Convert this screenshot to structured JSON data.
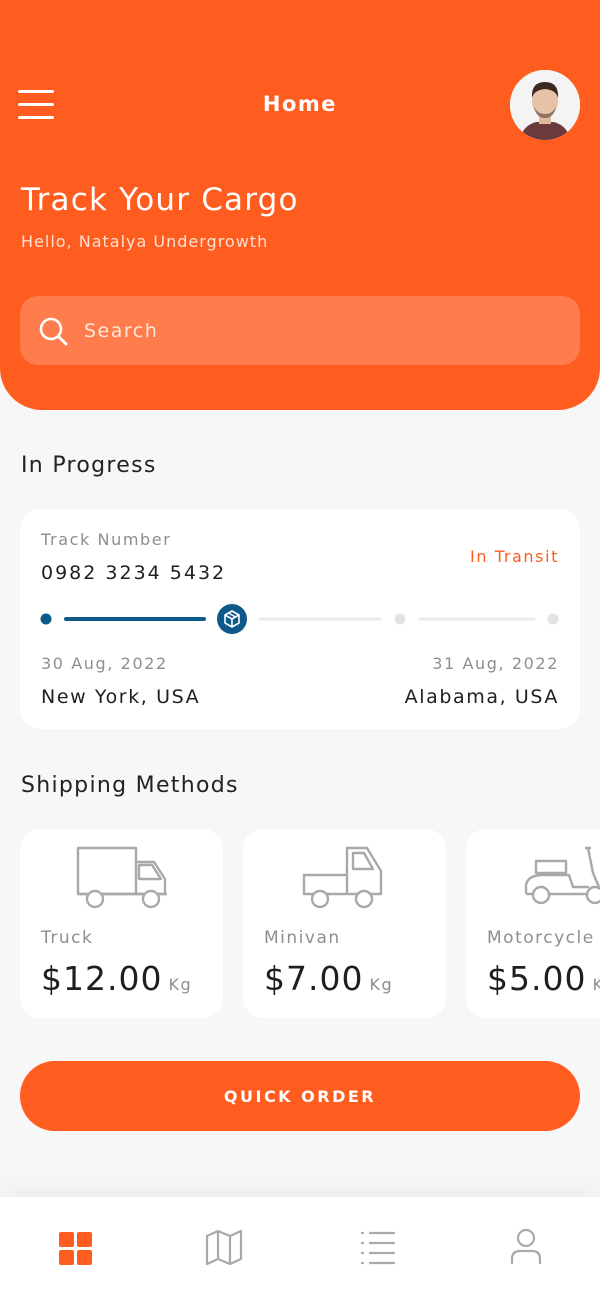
{
  "colors": {
    "brand": "#ff5c1f",
    "track_active": "#0e5a8a",
    "background": "#f7f7f7"
  },
  "header": {
    "title": "Home",
    "greeting_title": "Track Your Cargo",
    "greeting_sub": "Hello, Natalya Undergrowth",
    "menu_icon": "hamburger-icon",
    "avatar": "user-avatar"
  },
  "search": {
    "placeholder": "Search",
    "value": "",
    "icon": "search-icon"
  },
  "in_progress": {
    "title": "In Progress",
    "track_label": "Track Number",
    "track_number": "0982 3234 5432",
    "status": "In Transit",
    "progress_step": 2,
    "progress_steps_total": 4,
    "origin_date": "30 Aug, 2022",
    "origin": "New York, USA",
    "destination_date": "31 Aug, 2022",
    "destination": "Alabama, USA"
  },
  "shipping_methods": {
    "title": "Shipping Methods",
    "items": [
      {
        "name": "Truck",
        "price": "$12.00",
        "unit": "Kg",
        "icon": "truck-icon"
      },
      {
        "name": "Minivan",
        "price": "$7.00",
        "unit": "Kg",
        "icon": "minivan-icon"
      },
      {
        "name": "Motorcycle",
        "price": "$5.00",
        "unit": "Kg",
        "icon": "motorcycle-icon"
      }
    ]
  },
  "quick_order": {
    "label": "QUICK ORDER"
  },
  "bottom_nav": {
    "items": [
      {
        "icon": "grid-icon",
        "active": true
      },
      {
        "icon": "map-icon",
        "active": false
      },
      {
        "icon": "list-icon",
        "active": false
      },
      {
        "icon": "profile-icon",
        "active": false
      }
    ]
  }
}
